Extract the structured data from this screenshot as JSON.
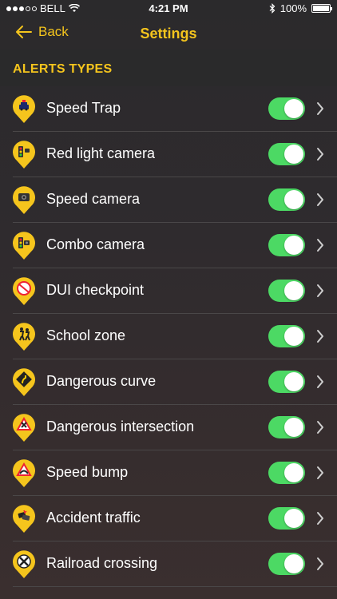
{
  "status": {
    "carrier": "BELL",
    "time": "4:21 PM",
    "battery": "100%",
    "battery_level": 1.0,
    "signal_bars_filled": 3,
    "signal_bars_total": 5
  },
  "nav": {
    "back_label": "Back",
    "title": "Settings"
  },
  "section": {
    "title": "ALERTS TYPES"
  },
  "colors": {
    "accent": "#f5c51d",
    "toggle_on": "#4cd964"
  },
  "alerts": [
    {
      "label": "Speed Trap",
      "icon": "police-car-icon",
      "enabled": true
    },
    {
      "label": "Red light camera",
      "icon": "traffic-light-camera-icon",
      "enabled": true
    },
    {
      "label": "Speed camera",
      "icon": "speed-camera-icon",
      "enabled": true
    },
    {
      "label": "Combo camera",
      "icon": "combo-camera-icon",
      "enabled": true
    },
    {
      "label": "DUI checkpoint",
      "icon": "dui-checkpoint-icon",
      "enabled": true
    },
    {
      "label": "School zone",
      "icon": "school-zone-icon",
      "enabled": true
    },
    {
      "label": "Dangerous curve",
      "icon": "dangerous-curve-icon",
      "enabled": true
    },
    {
      "label": "Dangerous intersection",
      "icon": "dangerous-intersection-icon",
      "enabled": true
    },
    {
      "label": "Speed bump",
      "icon": "speed-bump-icon",
      "enabled": true
    },
    {
      "label": "Accident traffic",
      "icon": "accident-traffic-icon",
      "enabled": true
    },
    {
      "label": "Railroad crossing",
      "icon": "railroad-crossing-icon",
      "enabled": true
    }
  ]
}
